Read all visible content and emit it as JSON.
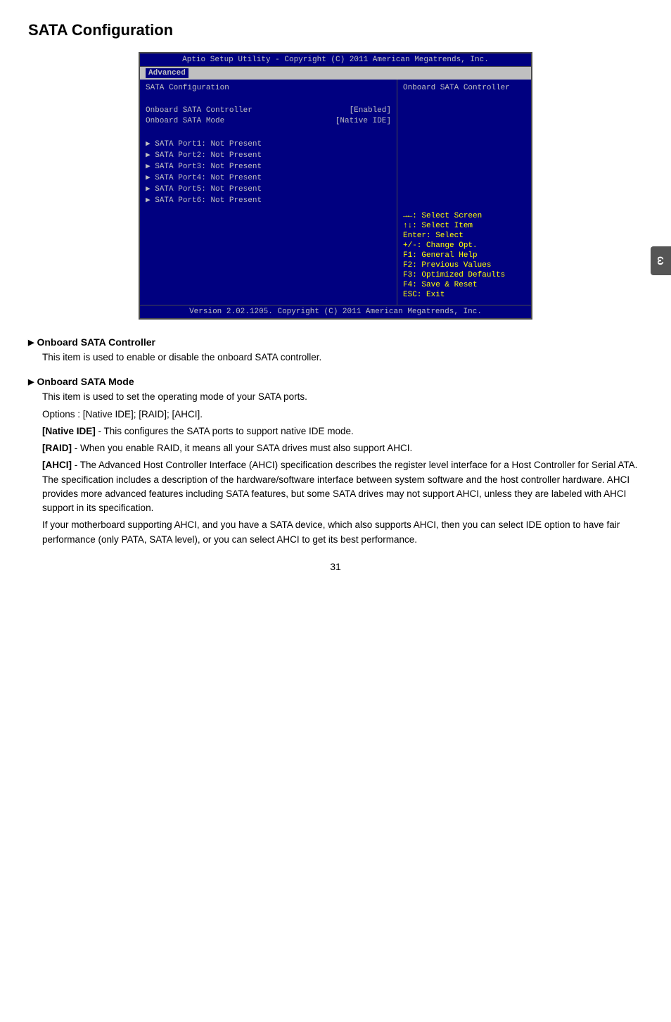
{
  "page": {
    "title": "SATA Configuration",
    "page_number": "31"
  },
  "bios": {
    "title_bar": "Aptio Setup Utility - Copyright (C) 2011 American Megatrends, Inc.",
    "menu_items": [
      "Advanced"
    ],
    "active_menu": "Advanced",
    "left_section_title": "SATA Configuration",
    "onboard_controller_label": "Onboard SATA Controller",
    "onboard_controller_value": "[Enabled]",
    "onboard_mode_label": "Onboard SATA Mode",
    "onboard_mode_value": "[Native IDE]",
    "ports": [
      "SATA Port1: Not Present",
      "SATA Port2: Not Present",
      "SATA Port3: Not Present",
      "SATA Port4: Not Present",
      "SATA Port5: Not Present",
      "SATA Port6: Not Present"
    ],
    "right_help_title": "Onboard SATA Controller",
    "help_items": [
      "→←: Select Screen",
      "↑↓: Select Item",
      "Enter: Select",
      "+/-: Change Opt.",
      "F1: General Help",
      "F2: Previous Values",
      "F3: Optimized Defaults",
      "F4: Save & Reset",
      "ESC: Exit"
    ],
    "footer": "Version 2.02.1205. Copyright (C) 2011 American Megatrends, Inc."
  },
  "documentation": {
    "sections": [
      {
        "heading": "Onboard SATA Controller",
        "paragraphs": [
          "This item is used to enable or disable the onboard SATA controller."
        ]
      },
      {
        "heading": "Onboard SATA Mode",
        "paragraphs": [
          "This item is used to set the operating mode of your SATA ports.",
          "Options : [Native IDE]; [RAID]; [AHCI].",
          "[Native IDE] - This configures the SATA ports to support native IDE mode.",
          "[RAID] - When you enable RAID, it means all your SATA drives must also support AHCI.",
          "[AHCI] - The Advanced Host Controller Interface (AHCI) specification describes the register level interface for a Host Controller for Serial ATA. The specification includes a description of the hardware/software interface between system software and the host controller hardware. AHCI provides more advanced features including SATA features, but some SATA drives may not support AHCI, unless they are labeled with AHCI support in its specification.",
          "If your motherboard supporting AHCI, and you have a SATA device, which also supports AHCI, then you can select IDE option to have fair performance (only PATA, SATA level), or you can select AHCI to get its best performance."
        ],
        "bold_items": [
          "[Native IDE]",
          "[RAID]",
          "[AHCI]"
        ]
      }
    ]
  },
  "sidebar": {
    "tab_label": "ω"
  }
}
